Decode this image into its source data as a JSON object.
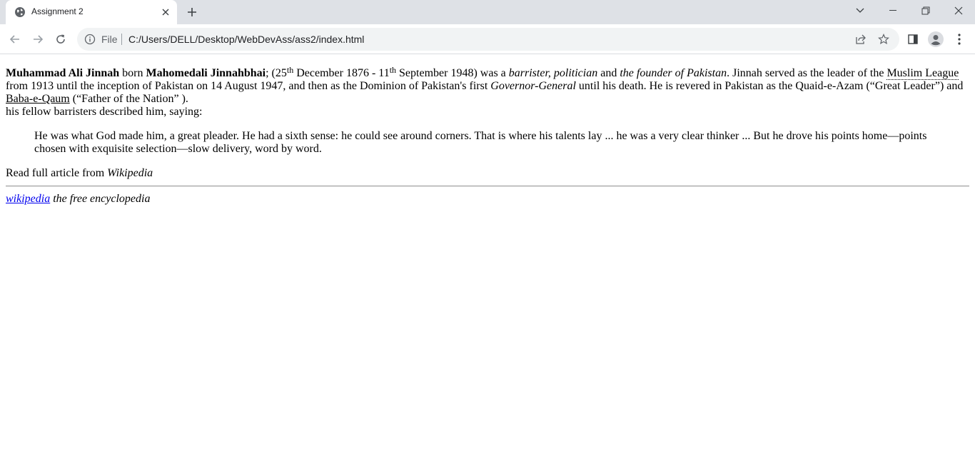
{
  "browser": {
    "tab_title": "Assignment 2",
    "scheme_label": "File",
    "url": "C:/Users/DELL/Desktop/WebDevAss/ass2/index.html"
  },
  "article": {
    "name_full": "Muhammad Ali Jinnah",
    "born_word": " born ",
    "born_name": "Mahomedali Jinnahbhai",
    "date_open": "; (25",
    "sup_th_1": "th",
    "date_mid": " December 1876 - 11",
    "sup_th_2": "th",
    "date_close": " September 1948) was a ",
    "roles": "barrister, politician",
    "and_word": " and ",
    "founder": "the founder of Pakistan",
    "served_text": ". Jinnah served as the leader of the ",
    "league": "Muslim League",
    "line2_a": " from 1913 until the inception of Pakistan on 14 August 1947, and then as the Dominion of Pakistan's first ",
    "governor": "Governor-General",
    "line2_b": " until his death. He is revered in Pakistan as the Quaid-e-Azam (“Great Leader”) and ",
    "baba": "Baba-e-Qaum",
    "line3": " (“Father of the Nation” ).",
    "fellow": "his fellow barristers described him, saying:",
    "quote": "He was what God made him, a great pleader. He had a sixth sense: he could see around corners. That is where his talents lay ... he was a very clear thinker ... But he drove his points home—points chosen with exquisite selection—slow delivery, word by word.",
    "read_full": "Read full article from ",
    "read_source": "Wikipedia"
  },
  "footer": {
    "link_text": "wikipedia",
    "tagline": " the free encyclopedia"
  }
}
